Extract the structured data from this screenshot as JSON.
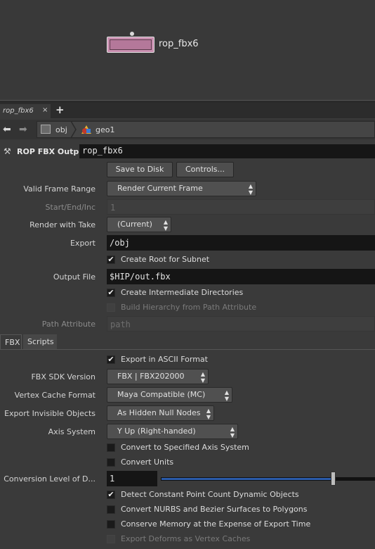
{
  "network": {
    "node_name": "rop_fbx6"
  },
  "tabs": {
    "active": "rop_fbx6",
    "close": "×",
    "add": "+"
  },
  "path": {
    "obj": "obj",
    "geo": "geo1"
  },
  "op": {
    "type": "ROP FBX Output",
    "name": "rop_fbx6"
  },
  "buttons": {
    "save": "Save to Disk",
    "controls": "Controls..."
  },
  "params": {
    "valid_frame_range": {
      "label": "Valid Frame Range",
      "value": "Render Current Frame"
    },
    "start_end_inc": {
      "label": "Start/End/Inc",
      "value": "1"
    },
    "render_with_take": {
      "label": "Render with Take",
      "value": "(Current)"
    },
    "export": {
      "label": "Export",
      "value": "/obj"
    },
    "create_root": {
      "label": "Create Root for Subnet",
      "checked": true
    },
    "output_file": {
      "label": "Output File",
      "value": "$HIP/out.fbx"
    },
    "create_dirs": {
      "label": "Create Intermediate Directories",
      "checked": true
    },
    "build_hierarchy": {
      "label": "Build Hierarchy from Path Attribute",
      "checked": false
    },
    "path_attribute": {
      "label": "Path Attribute",
      "value": "path"
    }
  },
  "subtabs": {
    "fbx": "FBX",
    "scripts": "Scripts"
  },
  "fbx": {
    "ascii": {
      "label": "Export in ASCII Format",
      "checked": true
    },
    "sdk_version": {
      "label": "FBX SDK Version",
      "value": "FBX | FBX202000"
    },
    "vertex_cache": {
      "label": "Vertex Cache Format",
      "value": "Maya Compatible (MC)"
    },
    "invisible": {
      "label": "Export Invisible Objects",
      "value": "As Hidden Null Nodes"
    },
    "axis_system": {
      "label": "Axis System",
      "value": "Y Up (Right-handed)"
    },
    "convert_axis": {
      "label": "Convert to Specified Axis System",
      "checked": false
    },
    "convert_units": {
      "label": "Convert Units",
      "checked": false
    },
    "conversion_level": {
      "label": "Conversion Level of D...",
      "value": "1",
      "slider_fraction": 0.8
    },
    "detect_constant": {
      "label": "Detect Constant Point Count Dynamic Objects",
      "checked": true
    },
    "convert_nurbs": {
      "label": "Convert NURBS and Bezier Surfaces to Polygons",
      "checked": false
    },
    "conserve_memory": {
      "label": "Conserve Memory at the Expense of Export Time",
      "checked": false
    },
    "export_deforms": {
      "label": "Export Deforms as Vertex Caches",
      "checked": false
    }
  }
}
